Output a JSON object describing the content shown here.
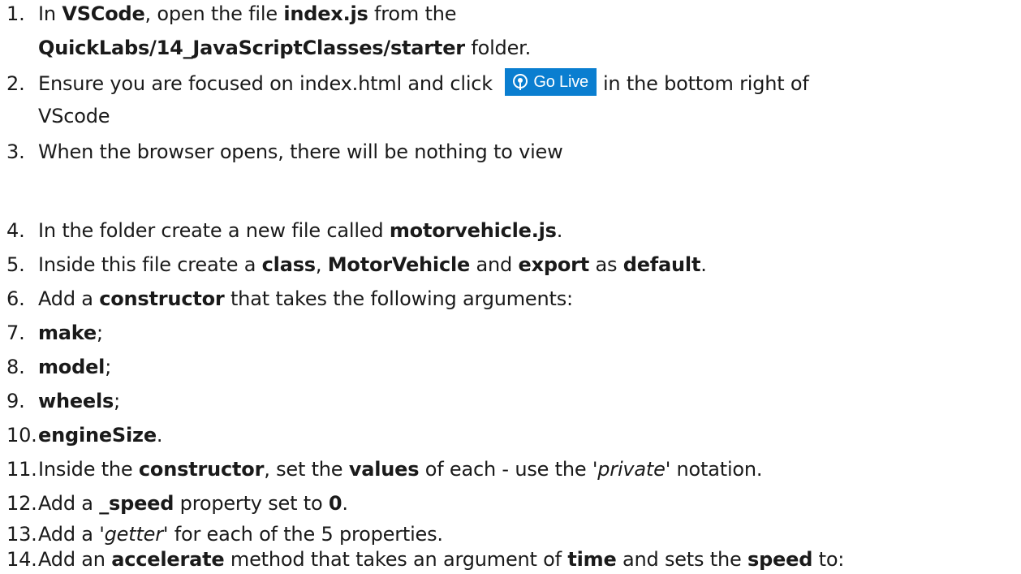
{
  "steps": [
    {
      "num": "1.",
      "parts": [
        "In ",
        "VSCode",
        ", open the file ",
        "index.js",
        " from the"
      ],
      "cont": [
        "QuickLabs/14_JavaScriptClasses/starter",
        " folder."
      ]
    },
    {
      "num": "2.",
      "parts": [
        "Ensure you are focused on index.html and click ",
        "in the bottom right of"
      ],
      "cont": [
        "VScode"
      ]
    },
    {
      "num": "3.",
      "parts": [
        "When the browser opens, there will be nothing to view"
      ]
    },
    {
      "num": "4.",
      "parts": [
        "In the folder create a new file called ",
        "motorvehicle.js",
        "."
      ]
    },
    {
      "num": "5.",
      "parts": [
        "Inside this file create a ",
        "class",
        ", ",
        "MotorVehicle",
        " and ",
        "export",
        " as ",
        "default",
        "."
      ]
    },
    {
      "num": "6.",
      "parts": [
        "Add a ",
        "constructor",
        " that takes the following arguments:"
      ]
    },
    {
      "num": "7.",
      "parts": [
        "make",
        ";"
      ]
    },
    {
      "num": "8.",
      "parts": [
        "model",
        ";"
      ]
    },
    {
      "num": "9.",
      "parts": [
        "wheels",
        ";"
      ]
    },
    {
      "num": "10.",
      "parts": [
        "engineSize",
        "."
      ]
    },
    {
      "num": "11.",
      "parts": [
        "Inside the ",
        "constructor",
        ", set the ",
        "values",
        " of each - use the ",
        "'private'",
        " notation."
      ]
    },
    {
      "num": "12.",
      "parts": [
        "Add a ",
        "_speed",
        " property set to ",
        "0",
        "."
      ]
    },
    {
      "num": "13.",
      "parts": [
        "Add a ",
        "'getter'",
        " for each of the 5 properties."
      ]
    },
    {
      "num": "14.",
      "parts": [
        "Add an ",
        "accelerate",
        " method that takes an argument of ",
        "time",
        " and sets the ",
        "speed",
        " to:"
      ]
    }
  ],
  "golive_button": {
    "label": "Go Live",
    "icon": "broadcast-icon",
    "color": "#0a7ed0"
  }
}
